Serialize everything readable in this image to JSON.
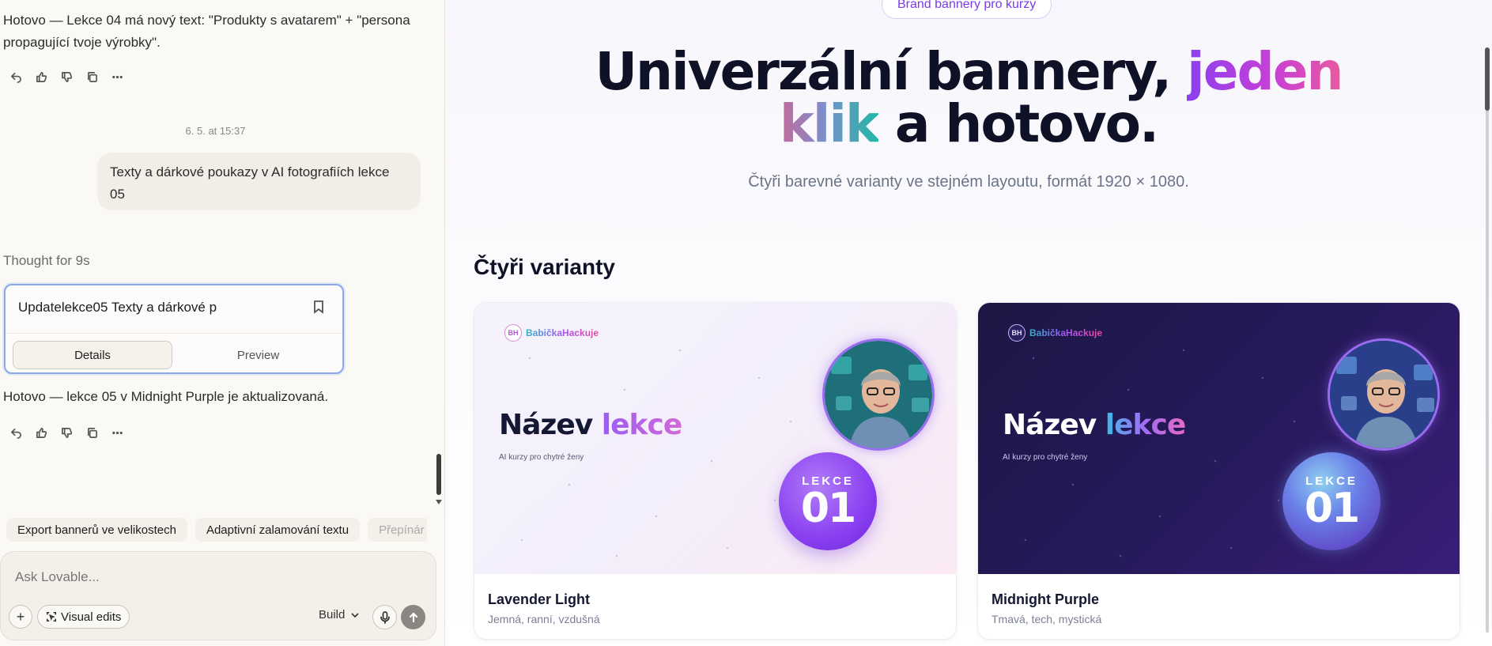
{
  "chat": {
    "messages": [
      {
        "line1": "Hotovo — Lekce 04 má nový text: \"Produkty s avatarem\" + \"persona",
        "line2": "propagující tvoje výrobky\"."
      }
    ],
    "timestamp": "6. 5. at 15:37",
    "user_message_line1": "Texty a dárkové poukazy v AI fotografiích lekce",
    "user_message_line2": "05",
    "thought": "Thought for 9s",
    "edit_card": {
      "title": "Updatelekce05 Texty a dárkové p",
      "details_label": "Details",
      "preview_label": "Preview"
    },
    "result_message": "Hotovo — lekce 05 v Midnight Purple je aktualizovaná.",
    "suggestions": [
      "Export bannerů ve velikostech",
      "Adaptivní zalamování textu",
      "Přepínár"
    ],
    "composer": {
      "placeholder": "Ask Lovable...",
      "visual_edits_label": "Visual edits",
      "mode_label": "Build"
    }
  },
  "preview": {
    "pill": "Brand bannery pro kurzy",
    "hero": {
      "line1_dark": "Univerzální bannery, ",
      "line1_accent": "jeden",
      "line2_accent": "klik",
      "line2_dark": " a hotovo."
    },
    "subtitle": "Čtyři barevné varianty ve stejném layoutu, formát 1920 × 1080.",
    "section_title": "Čtyři varianty",
    "variants": [
      {
        "brand": "BabičkaHackuje",
        "logo": "BH",
        "title_dark": "Název ",
        "title_accent": "lekce",
        "tagline": "AI kurzy pro chytré ženy",
        "badge_label": "LEKCE",
        "badge_number": "01",
        "name": "Lavender Light",
        "description": "Jemná, ranní, vzdušná"
      },
      {
        "brand": "BabičkaHackuje",
        "logo": "BH",
        "title_dark": "Název ",
        "title_accent": "lekce",
        "tagline": "AI kurzy pro chytré ženy",
        "badge_label": "LEKCE",
        "badge_number": "01",
        "name": "Midnight Purple",
        "description": "Tmavá, tech, mystická"
      }
    ]
  },
  "icons": [
    "undo-icon",
    "thumbs-up-icon",
    "thumbs-down-icon",
    "copy-icon",
    "more-icon",
    "bookmark-icon",
    "plus-icon",
    "visual-edits-icon",
    "chevron-down-icon",
    "mic-icon",
    "send-arrow-icon"
  ],
  "colors": {
    "accent_purple": "#7c3aed",
    "dark_navy": "#0f1226",
    "chat_bg": "#fbf9f6",
    "midnight_bg": "#271a5c"
  }
}
